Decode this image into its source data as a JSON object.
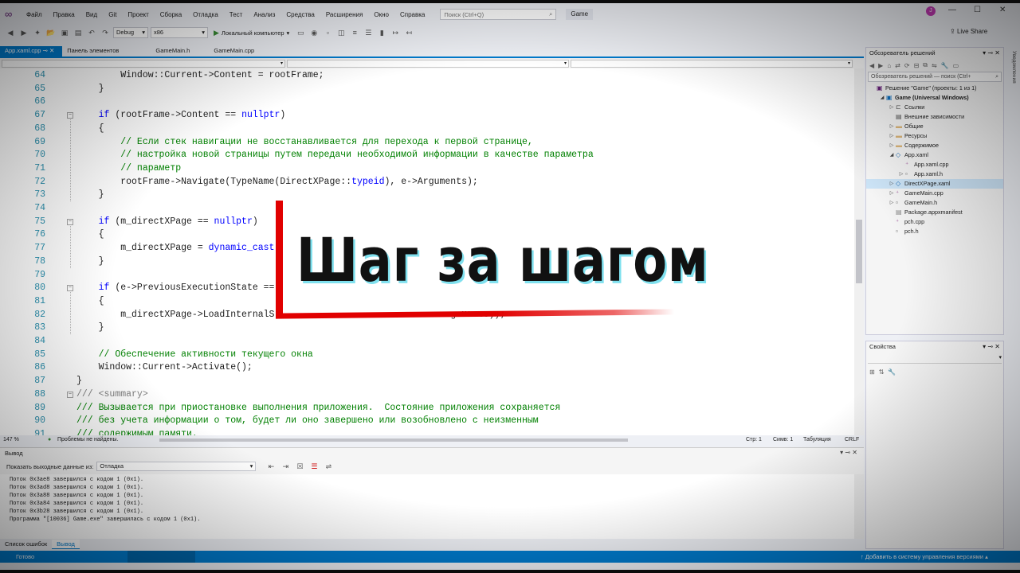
{
  "menu": {
    "items": [
      "Файл",
      "Правка",
      "Вид",
      "Git",
      "Проект",
      "Сборка",
      "Отладка",
      "Тест",
      "Анализ",
      "Средства",
      "Расширения",
      "Окно",
      "Справка"
    ],
    "search_placeholder": "Поиск (Ctrl+Q)",
    "solution_name": "Game",
    "avatar_initial": "J"
  },
  "toolbar": {
    "config": "Debug",
    "platform": "x86",
    "run_target": "Локальный компьютер",
    "live_share": "Live Share"
  },
  "tabs": {
    "active": "App.xaml.cpp",
    "others": [
      "Панель элементов",
      "GameMain.h",
      "GameMain.cpp"
    ]
  },
  "code_lines": [
    {
      "n": "64",
      "fold": "",
      "html": "        Window::Current->Content = rootFrame;"
    },
    {
      "n": "65",
      "fold": "",
      "html": "    }"
    },
    {
      "n": "66",
      "fold": "",
      "html": ""
    },
    {
      "n": "67",
      "fold": "⊟",
      "html": "    <span class=\"kw\">if</span> (rootFrame->Content == <span class=\"kw\">nullptr</span>)"
    },
    {
      "n": "68",
      "fold": "",
      "html": "    {"
    },
    {
      "n": "69",
      "fold": "",
      "html": "        <span class=\"cm\">// Если стек навигации не восстанавливается для перехода к первой странице,</span>"
    },
    {
      "n": "70",
      "fold": "",
      "html": "        <span class=\"cm\">// настройка новой страницы путем передачи необходимой информации в качестве параметра</span>"
    },
    {
      "n": "71",
      "fold": "",
      "html": "        <span class=\"cm\">// параметр</span>"
    },
    {
      "n": "72",
      "fold": "",
      "html": "        rootFrame->Navigate(TypeName(DirectXPage::<span class=\"kw\">typeid</span>), e->Arguments);"
    },
    {
      "n": "73",
      "fold": "",
      "html": "    }"
    },
    {
      "n": "74",
      "fold": "",
      "html": ""
    },
    {
      "n": "75",
      "fold": "⊟",
      "html": "    <span class=\"kw\">if</span> (m_directXPage == <span class=\"kw\">nullptr</span>)"
    },
    {
      "n": "76",
      "fold": "",
      "html": "    {"
    },
    {
      "n": "77",
      "fold": "",
      "html": "        m_directXPage = <span class=\"kw\">dynamic_cast</span>"
    },
    {
      "n": "78",
      "fold": "",
      "html": "    }"
    },
    {
      "n": "79",
      "fold": "",
      "html": ""
    },
    {
      "n": "80",
      "fold": "⊟",
      "html": "    <span class=\"kw\">if</span> (e->PreviousExecutionState =="
    },
    {
      "n": "81",
      "fold": "",
      "html": "    {"
    },
    {
      "n": "82",
      "fold": "",
      "html": "        m_directXPage->LoadInternalS                               ageState));"
    },
    {
      "n": "83",
      "fold": "",
      "html": "    }"
    },
    {
      "n": "84",
      "fold": "",
      "html": ""
    },
    {
      "n": "85",
      "fold": "",
      "html": "    <span class=\"cm\">// Обеспечение активности текущего окна</span>"
    },
    {
      "n": "86",
      "fold": "",
      "html": "    Window::Current->Activate();"
    },
    {
      "n": "87",
      "fold": "",
      "html": "}"
    },
    {
      "n": "88",
      "fold": "⊟",
      "html": "<span class=\"xdoc\">///</span> <span class=\"xdoc\">&lt;summary&gt;</span>"
    },
    {
      "n": "89",
      "fold": "",
      "html": "<span class=\"cm\">/// Вызывается при приостановке выполнения приложения.  Состояние приложения сохраняется</span>"
    },
    {
      "n": "90",
      "fold": "",
      "html": "<span class=\"cm\">/// без учета информации о том, будет ли оно завершено или возобновлено с неизменным</span>"
    },
    {
      "n": "91",
      "fold": "",
      "html": "<span class=\"cm\">/// содержимым памяти.</span>"
    }
  ],
  "editor_status": {
    "zoom": "147 %",
    "issues": "Проблемы не найдены.",
    "line": "Стр: 1",
    "col": "Симв: 1",
    "tabs": "Табуляция",
    "eol": "CRLF"
  },
  "output": {
    "title": "Вывод",
    "source_label": "Показать выходные данные из:",
    "source_value": "Отладка",
    "lines": [
      "Поток 0x3ae8 завершился с кодом 1 (0x1).",
      "Поток 0x3ad8 завершился с кодом 1 (0x1).",
      "Поток 0x3a88 завершился с кодом 1 (0x1).",
      "Поток 0x3a84 завершился с кодом 1 (0x1).",
      "Поток 0x3b28 завершился с кодом 1 (0x1).",
      "Программа \"[10036] Game.exe\" завершилась с кодом 1 (0x1)."
    ]
  },
  "bottom_tabs": [
    "Список ошибок",
    "Вывод"
  ],
  "statusbar": {
    "left": "Готово",
    "right": "↑ Добавить в систему управления версиями ▴"
  },
  "solution_explorer": {
    "title": "Обозреватель решений",
    "search": "Обозреватель решений — поиск (Ctrl+",
    "items": [
      {
        "label": "Решение \"Game\" (проекты: 1 из 1)",
        "depth": 0,
        "arrow": "",
        "icon": "solution",
        "bold": false,
        "selected": false
      },
      {
        "label": "Game (Universal Windows)",
        "depth": 1,
        "arrow": "◢",
        "icon": "project",
        "bold": true,
        "selected": false
      },
      {
        "label": "Ссылки",
        "depth": 2,
        "arrow": "▷",
        "icon": "refs",
        "bold": false,
        "selected": false
      },
      {
        "label": "Внешние зависимости",
        "depth": 2,
        "arrow": "",
        "icon": "deps",
        "bold": false,
        "selected": false
      },
      {
        "label": "Общие",
        "depth": 2,
        "arrow": "▷",
        "icon": "folder",
        "bold": false,
        "selected": false
      },
      {
        "label": "Ресурсы",
        "depth": 2,
        "arrow": "▷",
        "icon": "folder",
        "bold": false,
        "selected": false
      },
      {
        "label": "Содержимое",
        "depth": 2,
        "arrow": "▷",
        "icon": "folder",
        "bold": false,
        "selected": false
      },
      {
        "label": "App.xaml",
        "depth": 2,
        "arrow": "◢",
        "icon": "xaml",
        "bold": false,
        "selected": false
      },
      {
        "label": "App.xaml.cpp",
        "depth": 3,
        "arrow": "",
        "icon": "cpp",
        "bold": false,
        "selected": false
      },
      {
        "label": "App.xaml.h",
        "depth": 3,
        "arrow": "▷",
        "icon": "h",
        "bold": false,
        "selected": false
      },
      {
        "label": "DirectXPage.xaml",
        "depth": 2,
        "arrow": "▷",
        "icon": "xaml",
        "bold": false,
        "selected": true
      },
      {
        "label": "GameMain.cpp",
        "depth": 2,
        "arrow": "▷",
        "icon": "cpp",
        "bold": false,
        "selected": false
      },
      {
        "label": "GameMain.h",
        "depth": 2,
        "arrow": "▷",
        "icon": "h",
        "bold": false,
        "selected": false
      },
      {
        "label": "Package.appxmanifest",
        "depth": 2,
        "arrow": "",
        "icon": "manifest",
        "bold": false,
        "selected": false
      },
      {
        "label": "pch.cpp",
        "depth": 2,
        "arrow": "",
        "icon": "cpp",
        "bold": false,
        "selected": false
      },
      {
        "label": "pch.h",
        "depth": 2,
        "arrow": "",
        "icon": "h",
        "bold": false,
        "selected": false
      }
    ]
  },
  "properties": {
    "title": "Свойства"
  },
  "side_tab": "Уведомления",
  "overlay": {
    "title": "Шаг за шагом",
    "accent_color": "#e10000",
    "shadow_color": "#7fe0ee"
  }
}
